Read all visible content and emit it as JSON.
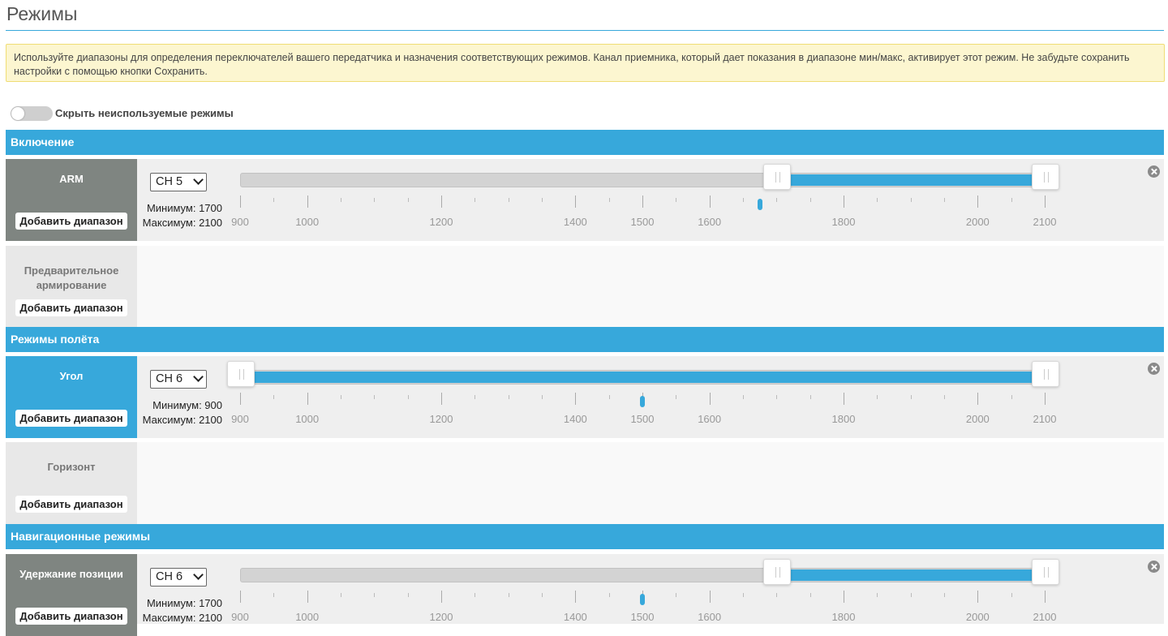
{
  "page": {
    "title": "Режимы",
    "note": "Используйте диапазоны для определения переключателей вашего передатчика и назначения соответствующих режимов. Канал приемника, который дает показания в диапазоне мин/макс, активирует этот режим. Не забудьте сохранить настройки с помощью кнопки Сохранить.",
    "hide_unused_label": "Скрыть неиспользуемые режимы",
    "hide_unused_on": false
  },
  "scale": {
    "min": 900,
    "max": 2100,
    "major_ticks": [
      900,
      1000,
      1200,
      1400,
      1500,
      1600,
      1800,
      2000,
      2100
    ],
    "labels": [
      "900",
      "1000",
      "1200",
      "1400",
      "1500",
      "1600",
      "1800",
      "2000",
      "2100"
    ]
  },
  "colors": {
    "accent": "#37a8db",
    "inactive_mode": "#7f8581",
    "note_bg": "#fcf6d0"
  },
  "groups": [
    {
      "title": "Включение",
      "modes": [
        {
          "name": "ARM",
          "add_label": "Добавить диапазон",
          "active": false,
          "range": {
            "channel": "CH 5",
            "min_label": "Минимум: 1700",
            "max_label": "Максимум: 2100",
            "min": 1700,
            "max": 2100,
            "current": 1675
          }
        },
        {
          "name": "Предварительное армирование",
          "add_label": "Добавить диапазон",
          "active": false,
          "range": null
        }
      ]
    },
    {
      "title": "Режимы полёта",
      "modes": [
        {
          "name": "Угол",
          "add_label": "Добавить диапазон",
          "active": true,
          "range": {
            "channel": "CH 6",
            "min_label": "Минимум: 900",
            "max_label": "Максимум: 2100",
            "min": 900,
            "max": 2100,
            "current": 1500
          }
        },
        {
          "name": "Горизонт",
          "add_label": "Добавить диапазон",
          "active": false,
          "range": null
        }
      ]
    },
    {
      "title": "Навигационные режимы",
      "modes": [
        {
          "name": "Удержание позиции",
          "add_label": "Добавить диапазон",
          "active": false,
          "range": {
            "channel": "CH 6",
            "min_label": "Минимум: 1700",
            "max_label": "Максимум: 2100",
            "min": 1700,
            "max": 2100,
            "current": 1500
          }
        }
      ]
    }
  ]
}
